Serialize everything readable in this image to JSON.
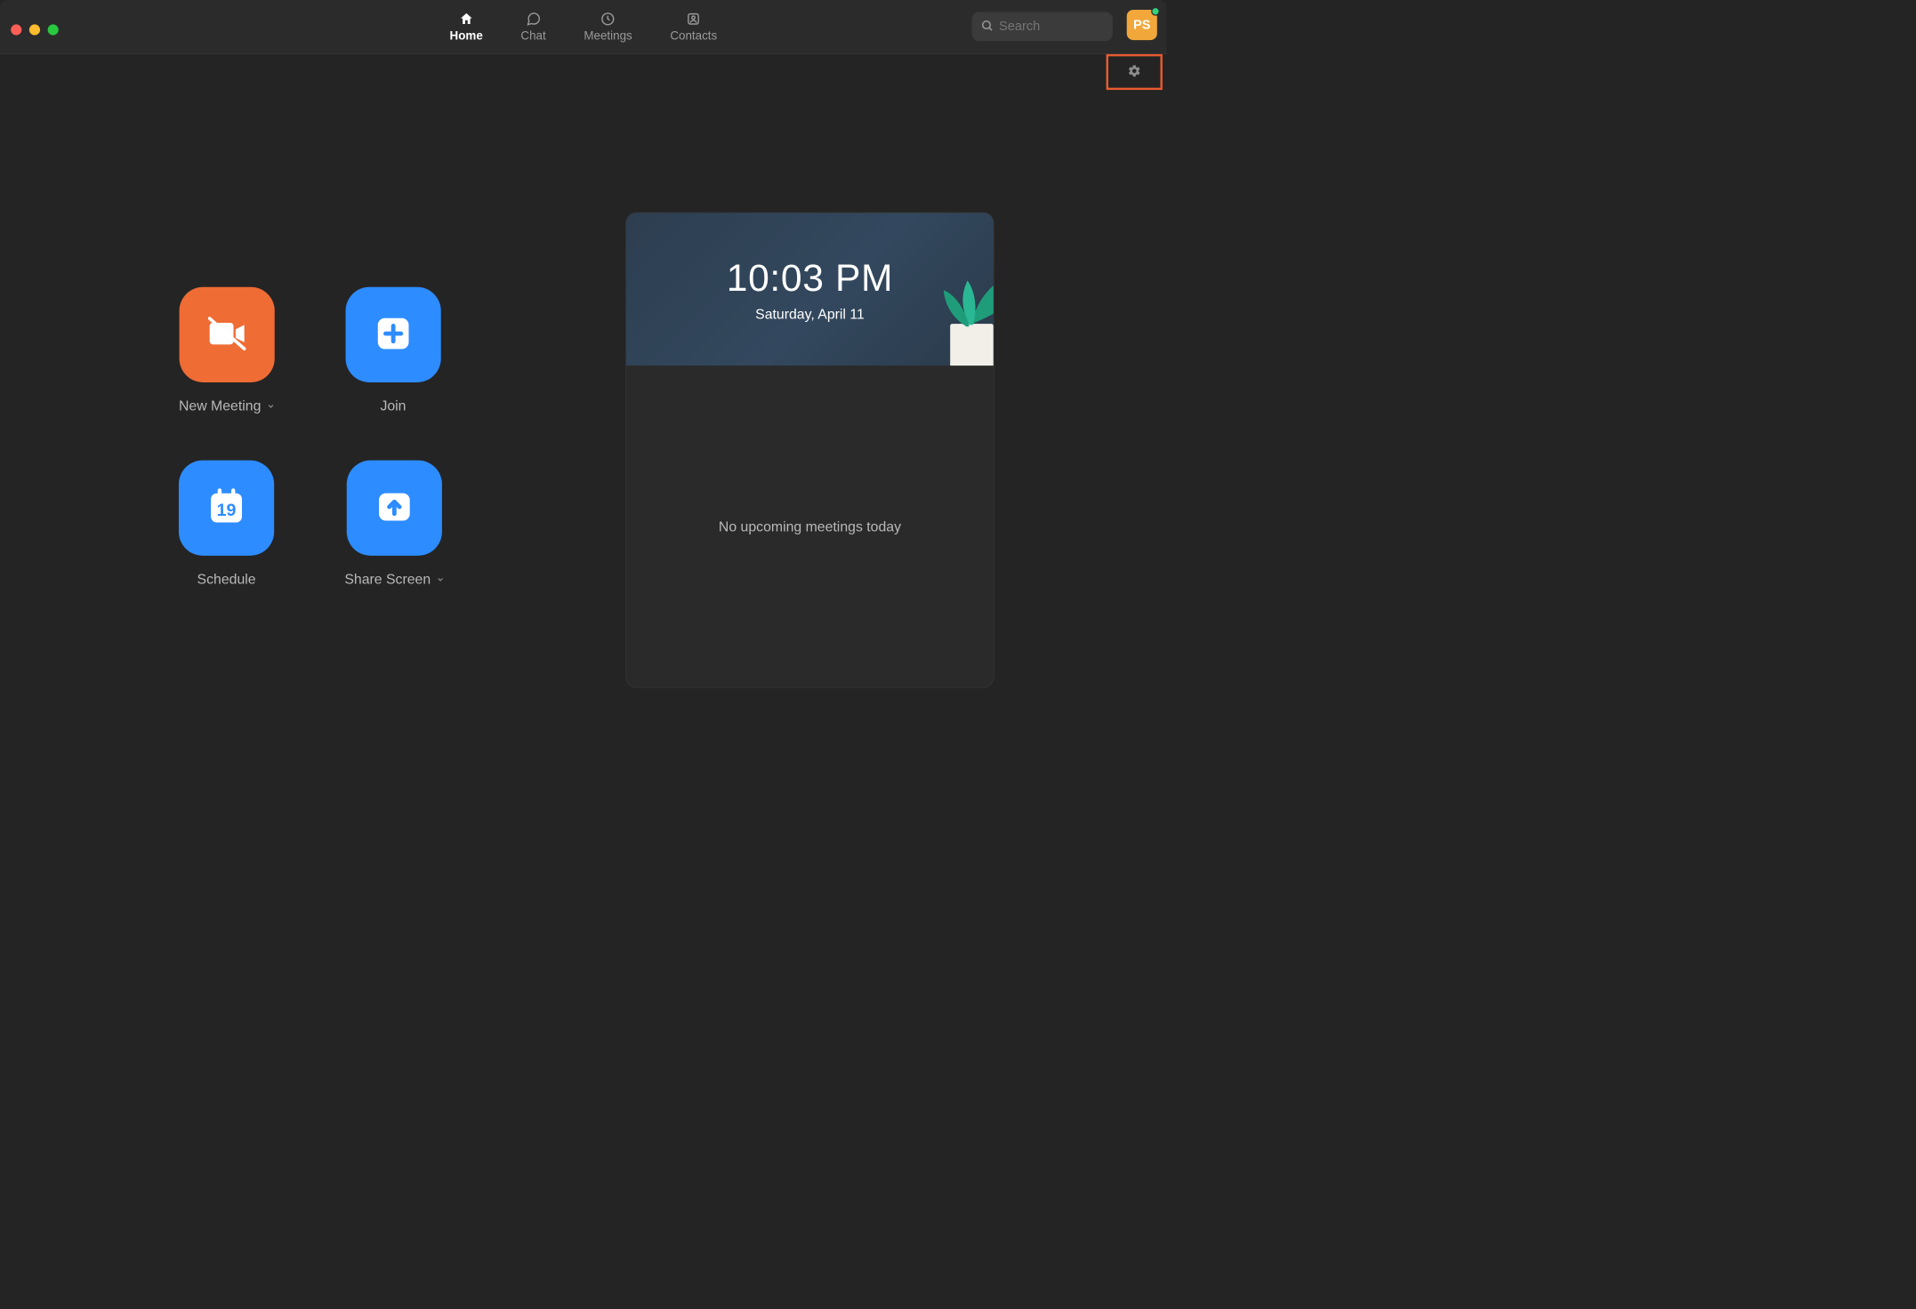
{
  "nav": {
    "tabs": [
      {
        "label": "Home",
        "active": true
      },
      {
        "label": "Chat",
        "active": false
      },
      {
        "label": "Meetings",
        "active": false
      },
      {
        "label": "Contacts",
        "active": false
      }
    ]
  },
  "search": {
    "placeholder": "Search"
  },
  "user": {
    "initials": "PS"
  },
  "actions": {
    "new_meeting": "New Meeting",
    "join": "Join",
    "schedule": "Schedule",
    "schedule_day": "19",
    "share_screen": "Share Screen"
  },
  "calendar": {
    "time": "10:03 PM",
    "date": "Saturday, April 11",
    "empty_msg": "No upcoming meetings today"
  },
  "colors": {
    "orange": "#ef6c35",
    "blue": "#2d8cff",
    "highlight": "#e85b2f"
  }
}
